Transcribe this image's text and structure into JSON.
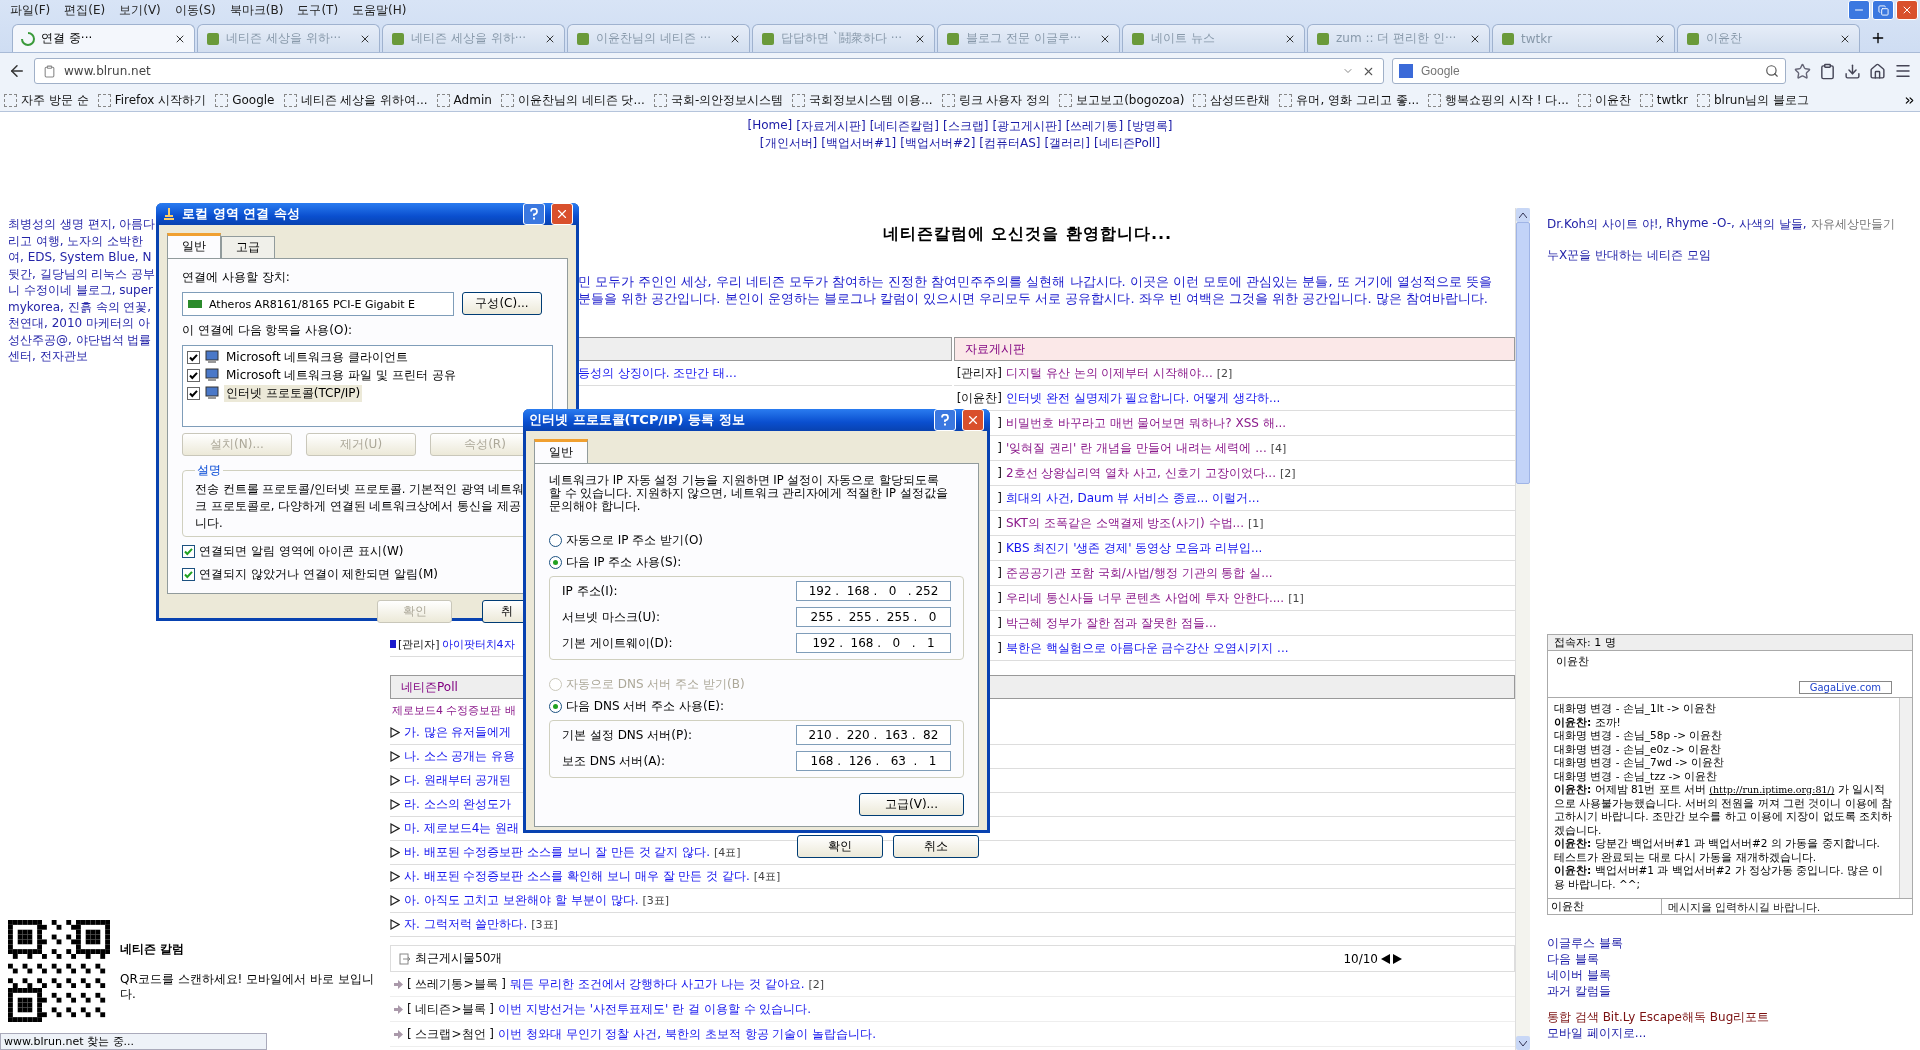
{
  "menu_bar": [
    "파일(F)",
    "편집(E)",
    "보기(V)",
    "이동(S)",
    "북마크(B)",
    "도구(T)",
    "도움말(H)"
  ],
  "tabs": [
    {
      "label": "연결 중···",
      "selected": true,
      "loading": true
    },
    {
      "label": "네티즌 세상을 위하···",
      "selected": false,
      "loading": false
    },
    {
      "label": "네티즌 세상을 위하···",
      "selected": false,
      "loading": false
    },
    {
      "label": "이윤찬님의 네티즌 ···",
      "selected": false,
      "loading": false
    },
    {
      "label": "답답하면 `鬪衆하다 ···",
      "selected": false,
      "loading": false
    },
    {
      "label": "블로그 전문 이글루···",
      "selected": false,
      "loading": false
    },
    {
      "label": "네이트 뉴스",
      "selected": false,
      "loading": false
    },
    {
      "label": "zum :: 더 편리한 인···",
      "selected": false,
      "loading": false
    },
    {
      "label": "twtkr",
      "selected": false,
      "loading": false
    },
    {
      "label": "이윤찬",
      "selected": false,
      "loading": false
    }
  ],
  "address_bar": {
    "value": "www.blrun.net"
  },
  "search_bar": {
    "placeholder": "Google"
  },
  "bookmarks": [
    "자주 방문 순",
    "Firefox 시작하기",
    "Google",
    "네티즌 세상을 위하여...",
    "Admin",
    "이윤찬님의 네티즌 닷...",
    "국회-의안정보시스템",
    "국회정보시스템 이용...",
    "링크 사용자 정의",
    "보고보고(bogozoa)",
    "삼성뜨란채",
    "유머, 영화 그리고 좋...",
    "행복쇼핑의 시작 ! 다...",
    "이윤찬",
    "twtkr",
    "blrun님의 블로그"
  ],
  "top_nav": [
    [
      "[Home]",
      "[자료게시판]",
      "[네티즌칼럼]",
      "[스크랩]",
      "[광고게시판]",
      "[쓰레기통]",
      "[방명록]"
    ],
    [
      "[개인서버]",
      "[백업서버#1]",
      "[백업서버#2]",
      "[컴퓨터AS]",
      "[갤러리]",
      "[네티즌Poll]"
    ]
  ],
  "left_links": [
    "최병성의 생명 편지, 아름다",
    "리고 여행, 노자의 소박한",
    "여, EDS, System Blue, N",
    "뒷간, 길당님의 리눅스 공부",
    "니 수정이네 블로그, super",
    "mykorea, 진흙 속의 연꽃,",
    "천연대, 2010 마케터의 아",
    "성산주공@, 야단법석 법률",
    "센터, 전자관보"
  ],
  "qr": {
    "title": "네티즌 칼럼",
    "caption": "QR코드를 스캔하세요! 모바일에서 바로 보입니다."
  },
  "welcome_title": "네티즌칼럼에 오신것을 환영합니다...",
  "intro_lines": [
    "민 모두가 주인인 세상, 우리 네티즌 모두가 참여하는 진정한 참여민주주의를 실현해 나갑시다. 이곳은 이런 모토에 관심있는 분들, 또 거기에 열성적으로 뜻을",
    "분들을 위한 공간입니다. 본인이 운영하는 블로그나 칼럼이 있으시면 우리모두 서로 공유합시다. 좌우 빈 여백은 그것을 위한 공간입니다. 많은 참여바랍니다."
  ],
  "left_board": {
    "rows": [
      {
        "title": "등성의 상징이다. 조만간 태..."
      },
      {
        "prefix": "[관리자]",
        "title": "아이팟터치4자"
      }
    ]
  },
  "right_board": {
    "title": "자료게시판",
    "rows": [
      {
        "prefix": "[관리자]",
        "title": "디지털 유산 논의 이제부터 시작해야...",
        "count": "[2]",
        "visited": true
      },
      {
        "prefix": "[이윤찬]",
        "title": "인터넷 완전 실명제가 필요합니다. 어떻게 생각하...",
        "visited": false
      },
      {
        "prefix": "]",
        "title": "비밀번호 바꾸라고 매번 물어보면 뭐하나? XSS 해...",
        "visited": true
      },
      {
        "prefix": "]",
        "title": "'잊혀질 권리' 란 개념을 만들어 내려는 세력에 ...",
        "count": "[4]",
        "visited": true
      },
      {
        "prefix": "]",
        "title": "2호선 상왕십리역 열차 사고, 신호기 고장이었다...",
        "count": "[2]",
        "visited": true
      },
      {
        "prefix": "]",
        "title": "희대의 사건, Daum 뷰 서비스 종료... 이럴거...",
        "visited": false
      },
      {
        "prefix": "]",
        "title": "SKT의 조폭같은 소액결제 방조(사기) 수법...",
        "count": "[1]",
        "visited": true
      },
      {
        "prefix": "]",
        "title": "KBS 최진기 '생존 경제' 동영상 모음과 리뷰입...",
        "visited": false
      },
      {
        "prefix": "]",
        "title": "준공공기관 포함 국회/사법/행정 기관의 통합 실...",
        "visited": true
      },
      {
        "prefix": "]",
        "title": "우리네 통신사들 너무 콘텐츠 사업에 투자 안한다....",
        "count": "[1]",
        "visited": true
      },
      {
        "prefix": "]",
        "title": "박근혜 정부가 잘한 점과 잘못한 점들...",
        "visited": true
      },
      {
        "prefix": "]",
        "title": "북한은 핵실험으로 아름다운 금수강산 오염시키지 ...",
        "visited": false
      }
    ]
  },
  "poll": {
    "title": "네티즌Poll",
    "question": "제로보드4 수정증보판 배",
    "options": [
      {
        "label": "가. 많은 유저들에게"
      },
      {
        "label": "나. 소스 공개는 유용"
      },
      {
        "label": "다. 원래부터 공개된"
      },
      {
        "label": "라. 소스의 완성도가"
      },
      {
        "label": "마. 제로보드4는 원래"
      },
      {
        "label": "바. 배포된 수정증보판 소스를 보니 잘 만든 것 같지 않다.",
        "votes": "[4표]"
      },
      {
        "label": "사. 배포된 수정증보판 소스를 확인해 보니 매우 잘 만든 것 같다.",
        "votes": "[4표]"
      },
      {
        "label": "아. 아직도 고치고 보완해야 할 부분이 많다.",
        "votes": "[3표]"
      },
      {
        "label": "자. 그럭저럭 쓸만하다.",
        "votes": "[3표]"
      }
    ]
  },
  "recent": {
    "title": "최근게시물50개",
    "page": "10/10",
    "posts": [
      {
        "category": "[ 쓰레기통>블록 ]",
        "title": "뭐든 무리한 조건에서 강행하다 사고가 나는 것 같아요.",
        "count": "[2]"
      },
      {
        "category": "[ 네티즌>블록 ]",
        "title": "이번 지방선거는 '사전투표제도' 란 걸 이용할 수 있습니다."
      },
      {
        "category": "[ 스크랩>첨언 ]",
        "title": "이번 청와대 무인기 정찰 사건, 북한의 초보적 항공 기술이 놀랍습니다."
      }
    ]
  },
  "right_links": [
    {
      "label": "Dr.Koh의 사이트 야!,",
      "visited": false
    },
    {
      "label": "Rhyme -O-,",
      "visited": false
    },
    {
      "label": "사색의 날들,",
      "visited": false
    },
    {
      "label": "자유세상만들기",
      "visited": true
    }
  ],
  "right_link_2": "누X꾼을 반대하는 네티즌 모임",
  "chat": {
    "header": "접속자: 1 명",
    "users": [
      "이윤찬"
    ],
    "brand": "GagaLive.com",
    "messages": [
      {
        "kind": "system",
        "text": "대화명 변경 - 손님_1lt -> 이윤찬"
      },
      {
        "kind": "chat",
        "speaker": "이윤찬:",
        "text": "조까!"
      },
      {
        "kind": "system",
        "text": "대화명 변경 - 손님_58p -> 이윤찬"
      },
      {
        "kind": "system",
        "text": "대화명 변경 - 손님_e0z -> 이윤찬"
      },
      {
        "kind": "system",
        "text": "대화명 변경 - 손님_7wd -> 이윤찬"
      },
      {
        "kind": "system",
        "text": "대화명 변경 - 손님_tzz -> 이윤찬"
      },
      {
        "kind": "chat",
        "speaker": "이윤찬:",
        "text": "어제밤 81번 포트 서버",
        "link": "(http://run.iptime.org:81/)",
        "text_after": "가 일시적으로 사용불가능했습니다. 서버의 전원을 꺼져 그런 것이니 이용에 참고하시기 바랍니다. 조만간 보수를 하고 이용에 지장이 없도록 조치하겠습니다."
      },
      {
        "kind": "chat",
        "speaker": "이윤찬:",
        "text": "당분간 백업서버#1 과 백업서버#2 의 가동을 중지합니다. 테스트가 완료되는 대로 다시 가동을 재개하겠습니다."
      },
      {
        "kind": "chat",
        "speaker": "이윤찬:",
        "text": "백업서버#1 과 백업서버#2 가 정상가동 중입니다. 많은 이용 바랍니다. ^^;"
      }
    ],
    "nickname": "이윤찬",
    "input_placeholder": "메시지을 입력하시길 바랍니다."
  },
  "right_links_bottom": [
    "이글루스 블록",
    "다음 블록",
    "네이버 블록",
    "과거 칼럼들"
  ],
  "right_links_footer": [
    "통합 검색 Bit.Ly Escape해독 Bug리포트",
    "모바일 페이지로..."
  ],
  "status_bar": "www.blrun.net 찾는 중...",
  "lan_dialog": {
    "title": "로컬 영역 연결 속성",
    "tabs": [
      {
        "label": "일반",
        "selected": true
      },
      {
        "label": "고급",
        "selected": false
      }
    ],
    "device_label": "연결에 사용할 장치:",
    "device": "Atheros AR8161/8165 PCI-E Gigabit E",
    "configure": "구성(C)...",
    "items_label": "이 연결에 다음 항목을 사용(O):",
    "items": [
      {
        "label": "Microsoft 네트워크용 클라이언트",
        "checked": true,
        "selected": false
      },
      {
        "label": "Microsoft 네트워크용 파일 및 프린터 공유",
        "checked": true,
        "selected": false
      },
      {
        "label": "인터넷 프로토콜(TCP/IP)",
        "checked": true,
        "selected": true
      }
    ],
    "buttons": [
      {
        "label": "설치(N)...",
        "disabled": true
      },
      {
        "label": "제거(U)",
        "disabled": true
      },
      {
        "label": "속성(R)",
        "disabled": true
      }
    ],
    "description_title": "설명",
    "description_lines": [
      "전송 컨트롤 프로토콜/인터넷 프로토콜. 기본적인 광역 네트워",
      "크 프로토콜로, 다양하게 연결된 네트워크상에서 통신을 제공",
      "니다."
    ],
    "options": [
      {
        "label": "연결되면 알림 영역에 아이콘 표시(W)",
        "checked": true
      },
      {
        "label": "연결되지 않았거나 연결이 제한되면 알림(M)",
        "checked": true
      }
    ],
    "footer_buttons": [
      {
        "label": "확인",
        "disabled": true
      },
      {
        "label": "취",
        "disabled": false
      }
    ]
  },
  "tcp_dialog": {
    "title": "인터넷 프로토콜(TCP/IP) 등록 정보",
    "tab": "일반",
    "description": "네트워크가 IP 자동 설정 기능을 지원하면 IP 설정이 자동으로 할당되도록 할 수 있습니다. 지원하지 않으면, 네트워크 관리자에게 적절한 IP 설정값을 문의해야 합니다.",
    "ip_modes": [
      {
        "label": "자동으로 IP 주소 받기(O)",
        "selected": false,
        "disabled": false
      },
      {
        "label": "다음 IP 주소 사용(S):",
        "selected": true,
        "disabled": false
      }
    ],
    "ip_fields": [
      {
        "label": "IP 주소(I):",
        "value": "192 .  168 .   0   . 252"
      },
      {
        "label": "서브넷 마스크(U):",
        "value": "255 .  255 .  255 .   0"
      },
      {
        "label": "기본 게이트웨이(D):",
        "value": "192 .  168 .   0   .   1"
      }
    ],
    "dns_modes": [
      {
        "label": "자동으로 DNS 서버 주소 받기(B)",
        "selected": false,
        "disabled": true
      },
      {
        "label": "다음 DNS 서버 주소 사용(E):",
        "selected": true,
        "disabled": false
      }
    ],
    "dns_fields": [
      {
        "label": "기본 설정 DNS 서버(P):",
        "value": "210 .  220 .  163 .  82"
      },
      {
        "label": "보조 DNS 서버(A):",
        "value": "168 .  126 .   63  .   1"
      }
    ],
    "advanced": "고급(V)...",
    "ok": "확인",
    "cancel": "취소"
  }
}
